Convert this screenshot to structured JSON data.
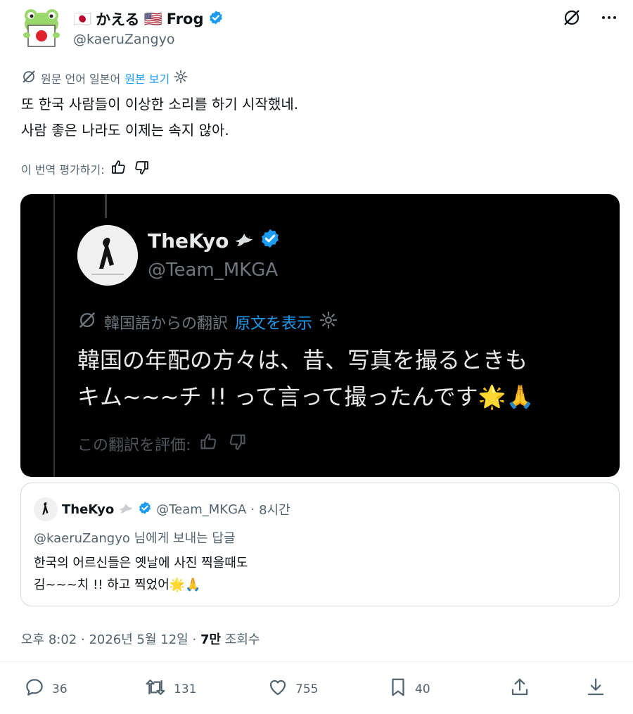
{
  "author": {
    "flag_jp": "🇯🇵",
    "name_jp": "かえる",
    "flag_us": "🇺🇸",
    "name_en": "Frog",
    "handle": "@kaeruZangyo"
  },
  "translation": {
    "label": "원문 언어 일본어",
    "show_original": "원본 보기"
  },
  "tweet": {
    "line1": "또 한국 사람들이 이상한 소리를 하기 시작했네.",
    "line2": "사람 좋은 나라도 이제는 속지 않아."
  },
  "rate_translation": "이 번역 평가하기:",
  "media": {
    "name": "TheKyo",
    "handle": "@Team_MKGA",
    "translated_from": "韓国語からの翻訳",
    "show_original": "原文を表示",
    "line1": "韓国の年配の方々は、昔、写真を撮るときも",
    "line2": "キム~~~チ !! って言って撮ったんです🌟🙏",
    "rate": "この翻訳を評価:"
  },
  "quote": {
    "name": "TheKyo",
    "handle": "@Team_MKGA",
    "time": "8시간",
    "reply_to": "@kaeruZangyo 님에게 보내는 답글",
    "line1": "한국의 어르신들은 옛날에 사진 찍을때도",
    "line2": "김~~~치 !! 하고 찍었어🌟🙏"
  },
  "meta": {
    "time": "오후 8:02",
    "date": "2026년 5월 12일",
    "views": "7만",
    "views_label": "조회수"
  },
  "actions": {
    "replies": "36",
    "reposts": "131",
    "likes": "755",
    "bookmarks": "40"
  },
  "colors": {
    "accent": "#1d9bf0",
    "verified": "#1d9bf0",
    "muted": "#536471"
  }
}
